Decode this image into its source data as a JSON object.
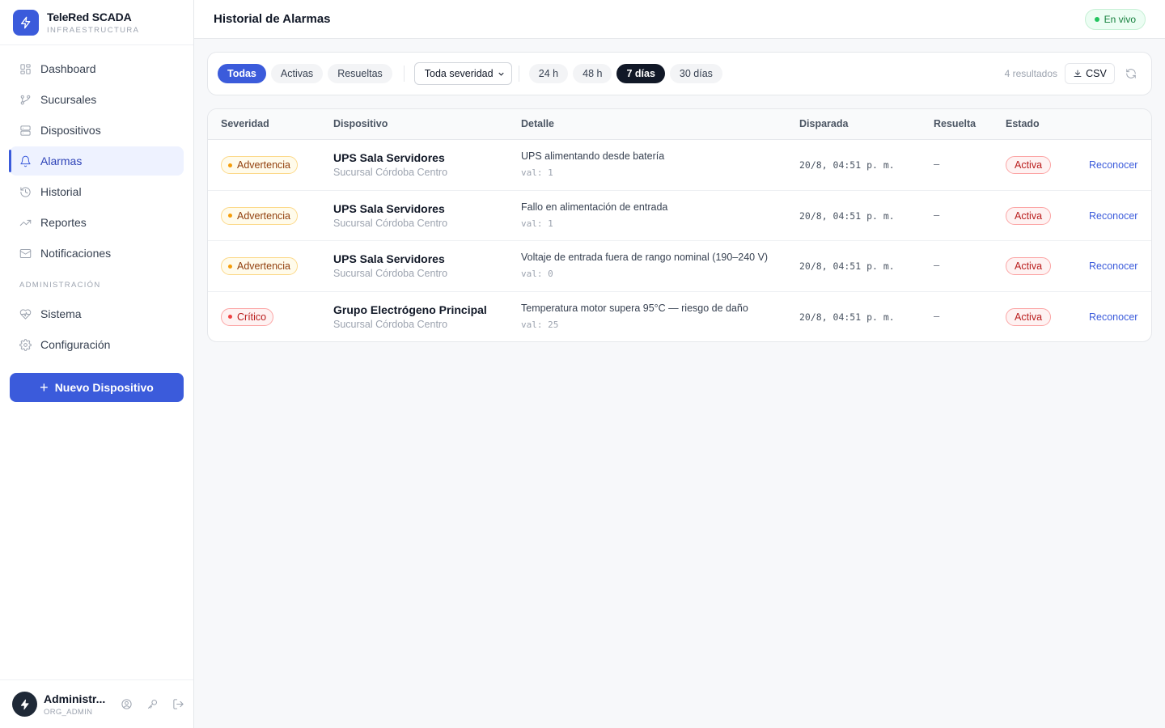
{
  "brand": {
    "name": "TeleRed SCADA",
    "subtitle": "INFRAESTRUCTURA"
  },
  "sidebar": {
    "items": [
      {
        "label": "Dashboard",
        "icon": "dashboard-icon"
      },
      {
        "label": "Sucursales",
        "icon": "branch-icon"
      },
      {
        "label": "Dispositivos",
        "icon": "server-icon"
      },
      {
        "label": "Alarmas",
        "icon": "bell-icon",
        "active": true
      },
      {
        "label": "Historial",
        "icon": "history-icon"
      },
      {
        "label": "Reportes",
        "icon": "trend-icon"
      },
      {
        "label": "Notificaciones",
        "icon": "mail-icon"
      }
    ],
    "admin_section": "ADMINISTRACIÓN",
    "admin_items": [
      {
        "label": "Sistema",
        "icon": "heart-pulse-icon"
      },
      {
        "label": "Configuración",
        "icon": "gear-icon"
      }
    ],
    "new_device_label": "Nuevo Dispositivo"
  },
  "user": {
    "name": "Administr...",
    "role": "ORG_ADMIN"
  },
  "header": {
    "title": "Historial de Alarmas",
    "live_label": "En vivo"
  },
  "filters": {
    "status_tabs": [
      "Todas",
      "Activas",
      "Resueltas"
    ],
    "status_selected": "Todas",
    "severity_select": "Toda severidad",
    "range_tabs": [
      "24 h",
      "48 h",
      "7 días",
      "30 días"
    ],
    "range_selected": "7 días",
    "results_count": "4 resultados",
    "csv_label": "CSV"
  },
  "table": {
    "columns": [
      "Severidad",
      "Dispositivo",
      "Detalle",
      "Disparada",
      "Resuelta",
      "Estado"
    ],
    "rows": [
      {
        "severity": "Advertencia",
        "severity_level": "warning",
        "device": "UPS Sala Servidores",
        "site": "Sucursal Córdoba Centro",
        "detail": "UPS alimentando desde batería",
        "value": "val: 1",
        "triggered": "20/8, 04:51 p. m.",
        "resolved": "–",
        "state": "Activa",
        "action": "Reconocer"
      },
      {
        "severity": "Advertencia",
        "severity_level": "warning",
        "device": "UPS Sala Servidores",
        "site": "Sucursal Córdoba Centro",
        "detail": "Fallo en alimentación de entrada",
        "value": "val: 1",
        "triggered": "20/8, 04:51 p. m.",
        "resolved": "–",
        "state": "Activa",
        "action": "Reconocer"
      },
      {
        "severity": "Advertencia",
        "severity_level": "warning",
        "device": "UPS Sala Servidores",
        "site": "Sucursal Córdoba Centro",
        "detail": "Voltaje de entrada fuera de rango nominal (190–240 V)",
        "value": "val: 0",
        "triggered": "20/8, 04:51 p. m.",
        "resolved": "–",
        "state": "Activa",
        "action": "Reconocer"
      },
      {
        "severity": "Crítico",
        "severity_level": "critical",
        "device": "Grupo Electrógeno Principal",
        "site": "Sucursal Córdoba Centro",
        "detail": "Temperatura motor supera 95°C — riesgo de daño",
        "value": "val: 25",
        "triggered": "20/8, 04:51 p. m.",
        "resolved": "–",
        "state": "Activa",
        "action": "Reconocer"
      }
    ]
  },
  "colors": {
    "accent": "#3b5bdb",
    "live": "#22c55e",
    "warning": "#f59e0b",
    "critical": "#ef4444"
  }
}
